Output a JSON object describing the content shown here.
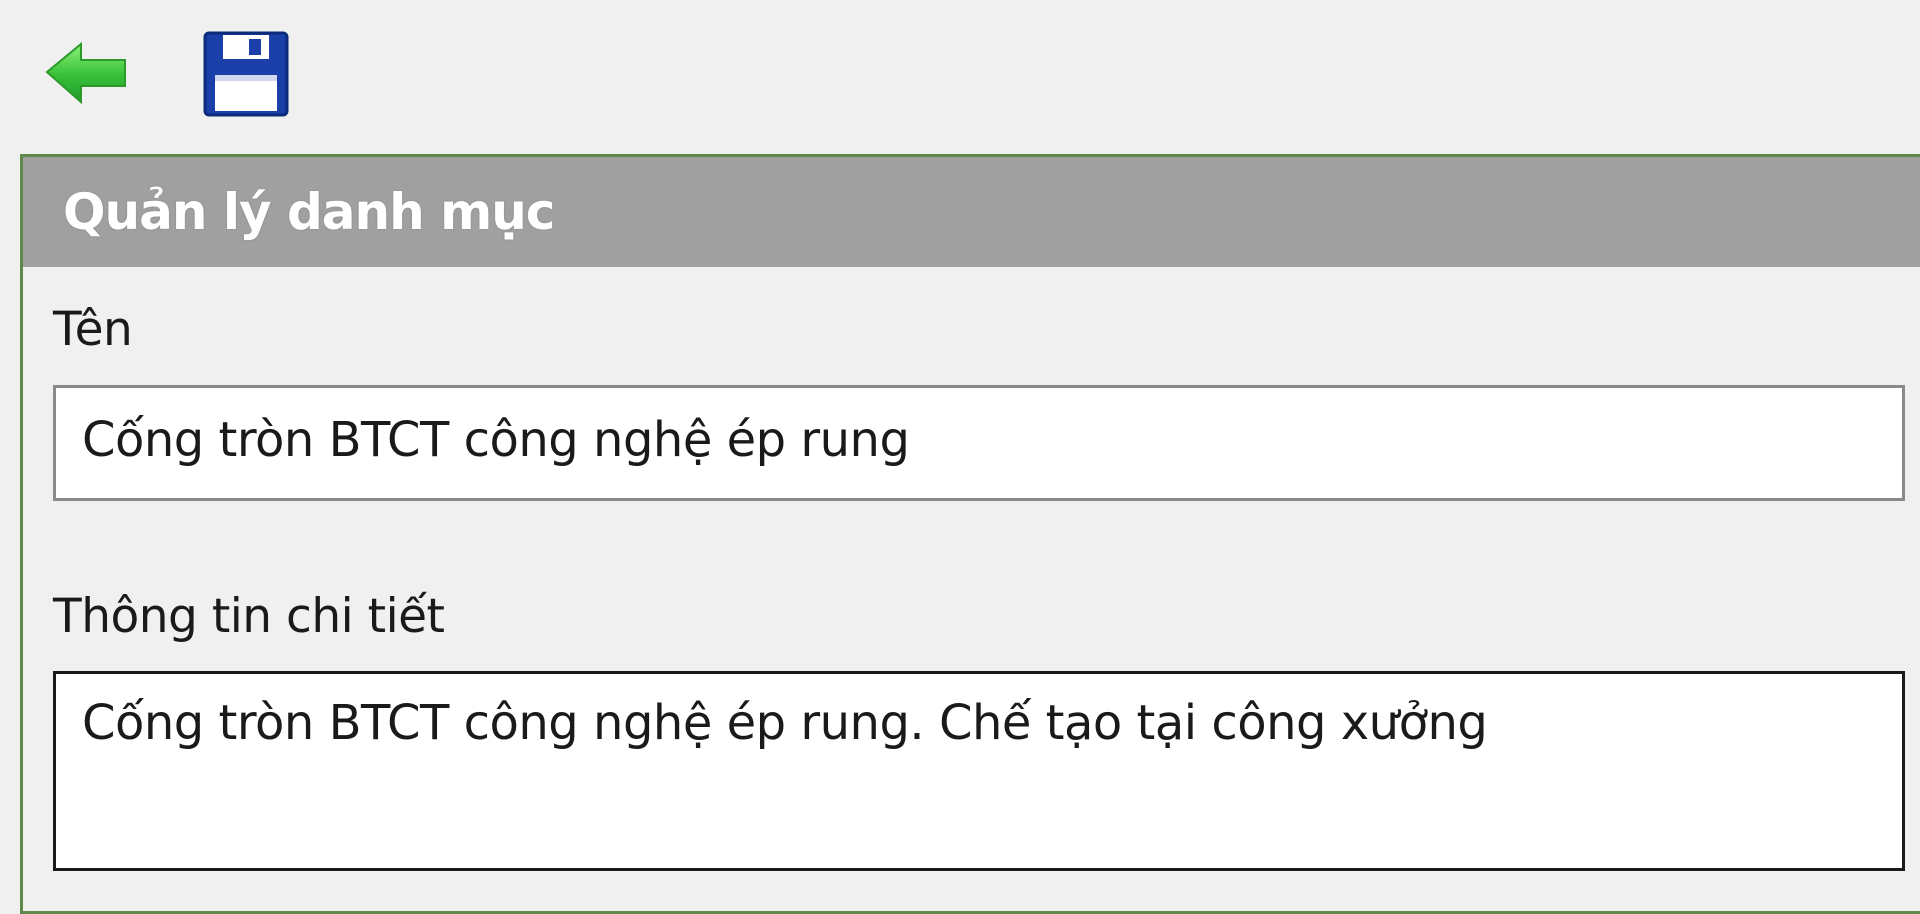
{
  "toolbar": {
    "back_icon": "back-arrow-icon",
    "save_icon": "floppy-disk-icon",
    "colors": {
      "back_arrow": "#3cc43c",
      "save_disk": "#1a3fa8"
    }
  },
  "panel": {
    "title": "Quản lý danh mục",
    "header_color": "#a0a0a0",
    "border_color": "#5f8a4a"
  },
  "form": {
    "name_label": "Tên",
    "name_value": "Cống tròn BTCT công nghệ ép rung",
    "detail_label": "Thông tin chi tiết",
    "detail_value": "Cống tròn BTCT công nghệ ép rung. Chế tạo tại công xưởng"
  }
}
